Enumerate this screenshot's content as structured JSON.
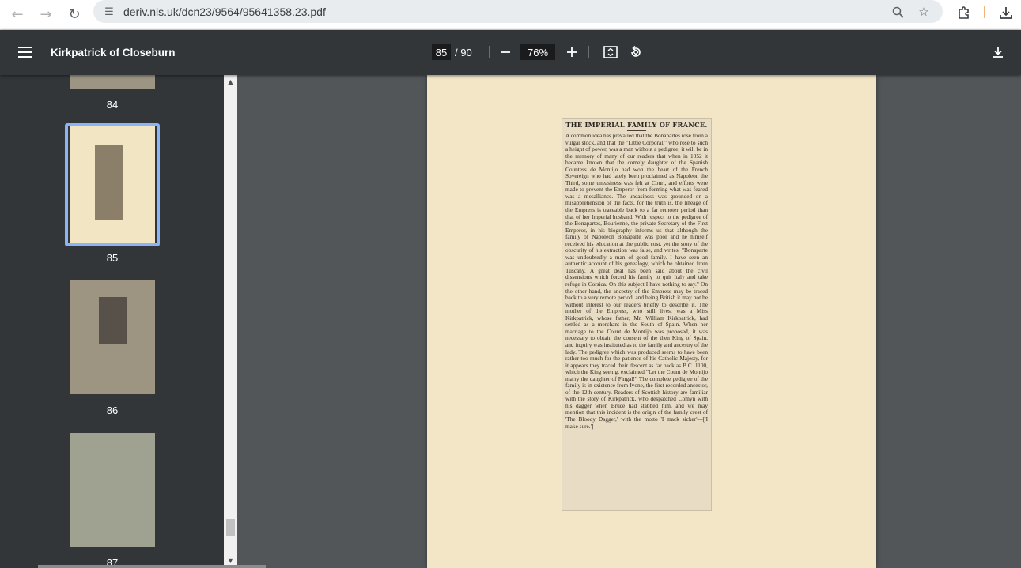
{
  "browser": {
    "url": "deriv.nls.uk/dcn23/9564/95641358.23.pdf",
    "icons": [
      "back-icon",
      "forward-icon",
      "reload-icon",
      "site-info-icon",
      "zoom-icon",
      "bookmark-star-icon",
      "extensions-icon",
      "download-icon"
    ]
  },
  "toolbar": {
    "title": "Kirkpatrick of Closeburn",
    "page_current": "85",
    "page_total": "/ 90",
    "zoom": "76%",
    "icons": [
      "menu-icon",
      "zoom-out-icon",
      "zoom-in-icon",
      "fit-page-icon",
      "rotate-icon",
      "download-icon"
    ]
  },
  "sidebar": {
    "thumbnails": [
      {
        "label": "84"
      },
      {
        "label": "85",
        "selected": true
      },
      {
        "label": "86"
      },
      {
        "label": "87"
      }
    ]
  },
  "document": {
    "clipping_title": "THE IMPERIAL FAMILY OF FRANCE.",
    "clipping_body": "A common idea has prevailed that the Bonapartes rose from a vulgar stock, and that the \"Little Corporal,\" who rose to such a height of power, was a man without a pedigree; it will be in the memory of many of our readers that when in 1852 it became known that the comely daughter of the Spanish Countess de Montijo had won the heart of the French Sovereign who had lately been proclaimed as Napoleon the Third, some uneasiness was felt at Court, and efforts were made to prevent the Emperor from forming what was feared was a mesalliance. The uneasiness was grounded on a misapprehension of the facts, for the truth is, the lineage of the Empress is traceable back to a far remoter period than that of her Imperial husband. With respect to the pedigree of the Bonapartes, Bourienne, the private Secretary of the First Emperor, in his biography informs us that although the family of Napoleon Bonaparte was poor and he himself received his education at the public cost, yet the story of the obscurity of his extraction was false, and writes: \"Bonaparte was undoubtedly a man of good family. I have seen an authentic account of his genealogy, which he obtained from Tuscany. A great deal has been said about the civil dissensions which forced his family to quit Italy and take refuge in Corsica. On this subject I have nothing to say.\" On the other hand, the ancestry of the Empress may be traced back to a very remote period, and being British it may not be without interest to our readers briefly to describe it. The mother of the Empress, who still lives, was a Miss Kirkpatrick, whose father, Mr. William Kirkpatrick, had settled as a merchant in the South of Spain. When her marriage to the Count de Montijo was proposed, it was necessary to obtain the consent of the then King of Spain, and inquiry was instituted as to the family and ancestry of the lady. The pedigree which was produced seems to have been rather too much for the patience of his Catholic Majesty, for it appears they traced their descent as far back as B.C. 1100, which the King seeing, exclaimed \"Let the Count de Montijo marry the daughter of Fingal!\" The complete pedigree of the family is in existence from Ivone, the first recorded ancestor, of the 12th century. Readers of Scottish history are familiar with the story of Kirkpatrick, who despatched Comyn with his dagger when Bruce had stabbed him, and we may mention that this incident is the origin of the family crest of 'The Bloody Dagger,' with the motto 'I mack sicker'—['I make sure.']"
  }
}
